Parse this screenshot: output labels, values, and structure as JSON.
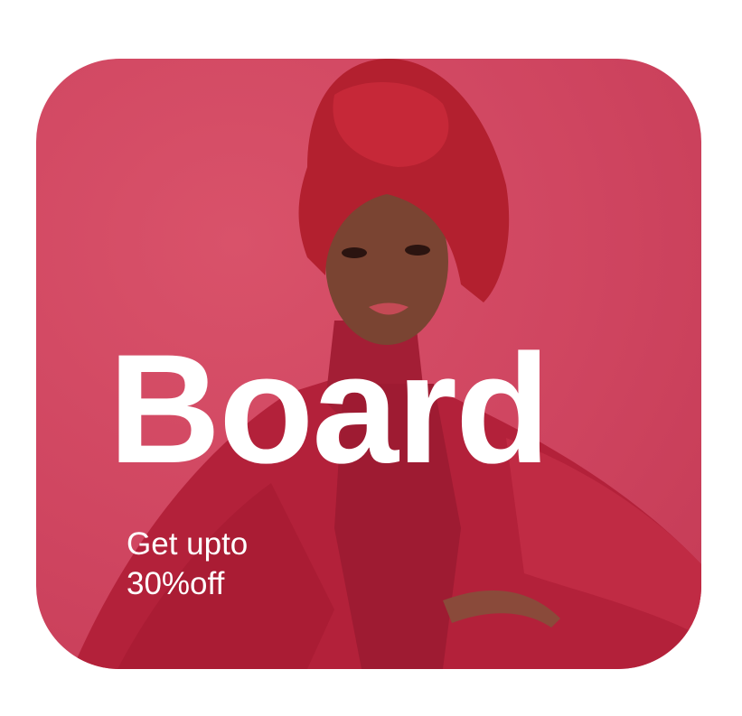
{
  "banner": {
    "title": "Board",
    "promo_line1": "Get upto",
    "promo_line2": "30%off"
  },
  "colors": {
    "background": "#cf4560",
    "garment": "#b3213a",
    "text": "#ffffff"
  }
}
